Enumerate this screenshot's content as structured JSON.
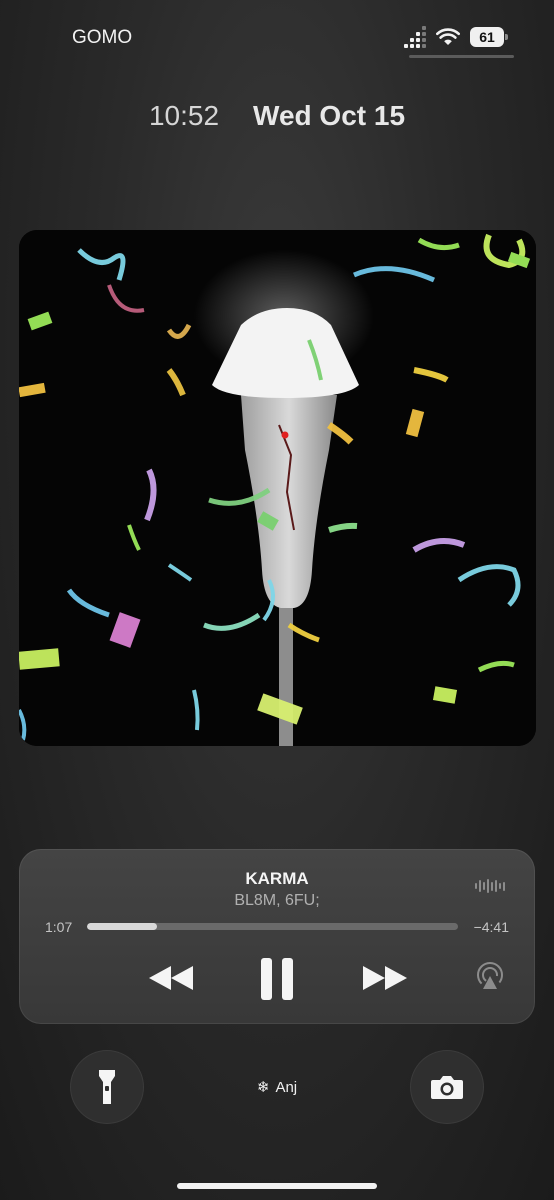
{
  "status_bar": {
    "carrier": "GOMO",
    "battery": "61",
    "signal_icon": "cellular-signal-icon",
    "wifi_icon": "wifi-icon"
  },
  "lockscreen": {
    "time": "10:52",
    "date": "Wed Oct 15"
  },
  "now_playing": {
    "title": "KARMA",
    "artist": "BL8M, 6FU;",
    "elapsed": "1:07",
    "remaining": "−4:41",
    "progress": 0.19,
    "state": "playing",
    "controls": {
      "rewind_icon": "rewind-icon",
      "pause_icon": "pause-icon",
      "forward_icon": "fast-forward-icon",
      "airplay_icon": "airplay-icon"
    }
  },
  "quick_actions": {
    "left_icon": "flashlight-icon",
    "right_icon": "camera-icon"
  },
  "focus": {
    "icon": "snowflake-icon",
    "glyph": "❄",
    "label": "Anj"
  },
  "colors": {
    "background": "#2a2a2a",
    "widget": "#3d3d3d",
    "progress_fill": "#d8d8d8",
    "progress_track": "#6a6a6a"
  }
}
